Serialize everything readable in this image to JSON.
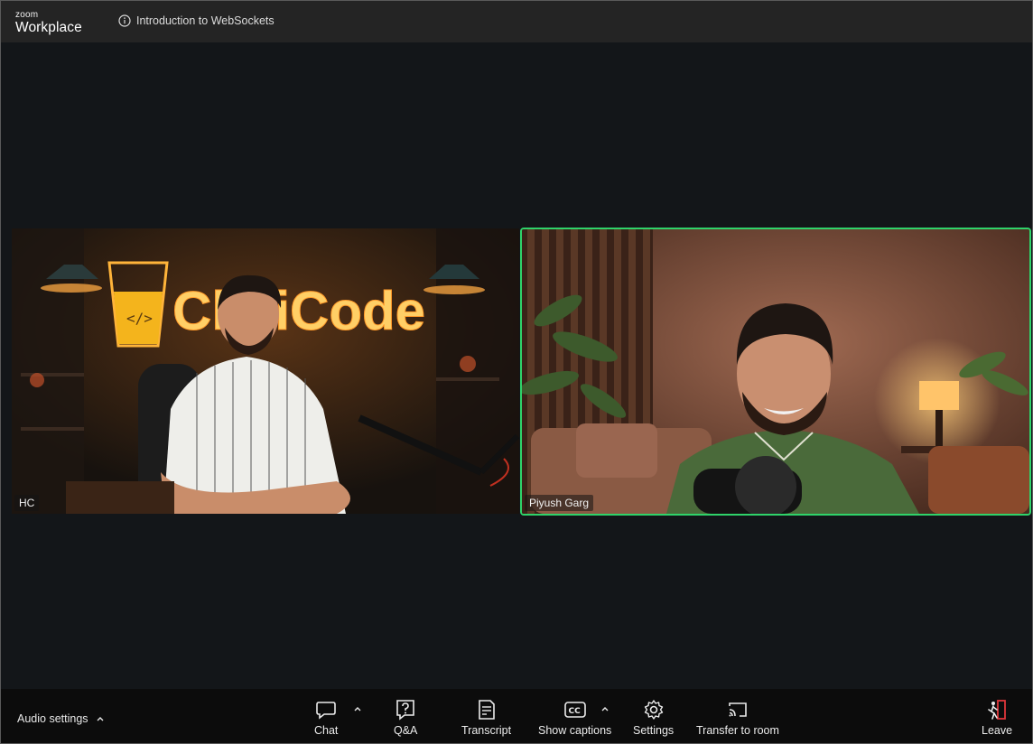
{
  "app": {
    "logo_line1": "zoom",
    "logo_line2": "Workplace",
    "meeting_title": "Introduction to WebSockets",
    "accent_color": "#2fd36a"
  },
  "participants": [
    {
      "name": "HC",
      "active_speaker": false
    },
    {
      "name": "Piyush Garg",
      "active_speaker": true
    }
  ],
  "video_text": {
    "neon_sign": "ChaiCode"
  },
  "toolbar": {
    "audio_settings": "Audio settings",
    "chat": "Chat",
    "qa": "Q&A",
    "transcript": "Transcript",
    "captions": "Show captions",
    "settings": "Settings",
    "transfer": "Transfer to room",
    "leave": "Leave"
  },
  "icons": {
    "info": "info-icon",
    "chat": "chat-bubble-icon",
    "qa": "question-box-icon",
    "transcript": "document-lines-icon",
    "captions": "cc-icon",
    "settings": "gear-icon",
    "transfer": "cast-icon",
    "leave": "exit-door-icon"
  }
}
